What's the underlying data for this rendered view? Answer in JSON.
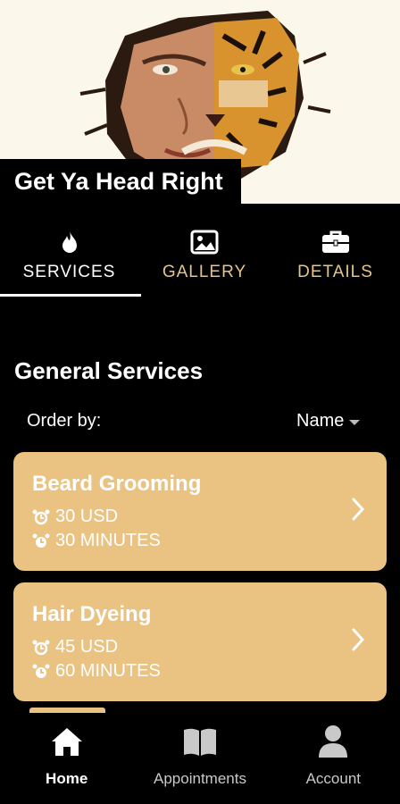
{
  "header": {
    "brand_name": "Get Ya Head Right"
  },
  "tabs": [
    {
      "label": "SERVICES",
      "icon": "flame-icon",
      "active": true
    },
    {
      "label": "GALLERY",
      "icon": "image-icon",
      "active": false
    },
    {
      "label": "DETAILS",
      "icon": "briefcase-icon",
      "active": false
    }
  ],
  "section": {
    "title": "General Services"
  },
  "order": {
    "label": "Order by:",
    "value": "Name"
  },
  "services": [
    {
      "name": "Beard Grooming",
      "price": "30 USD",
      "duration": "30 MINUTES"
    },
    {
      "name": "Hair Dyeing",
      "price": "45 USD",
      "duration": "60 MINUTES"
    }
  ],
  "nav": [
    {
      "label": "Home",
      "icon": "home-icon",
      "active": true
    },
    {
      "label": "Appointments",
      "icon": "book-icon",
      "active": false
    },
    {
      "label": "Account",
      "icon": "user-icon",
      "active": false
    }
  ],
  "colors": {
    "accent": "#eac282",
    "tab_inactive": "#e6c48a",
    "background": "#000000",
    "hero_bg": "#fbf7ea"
  }
}
